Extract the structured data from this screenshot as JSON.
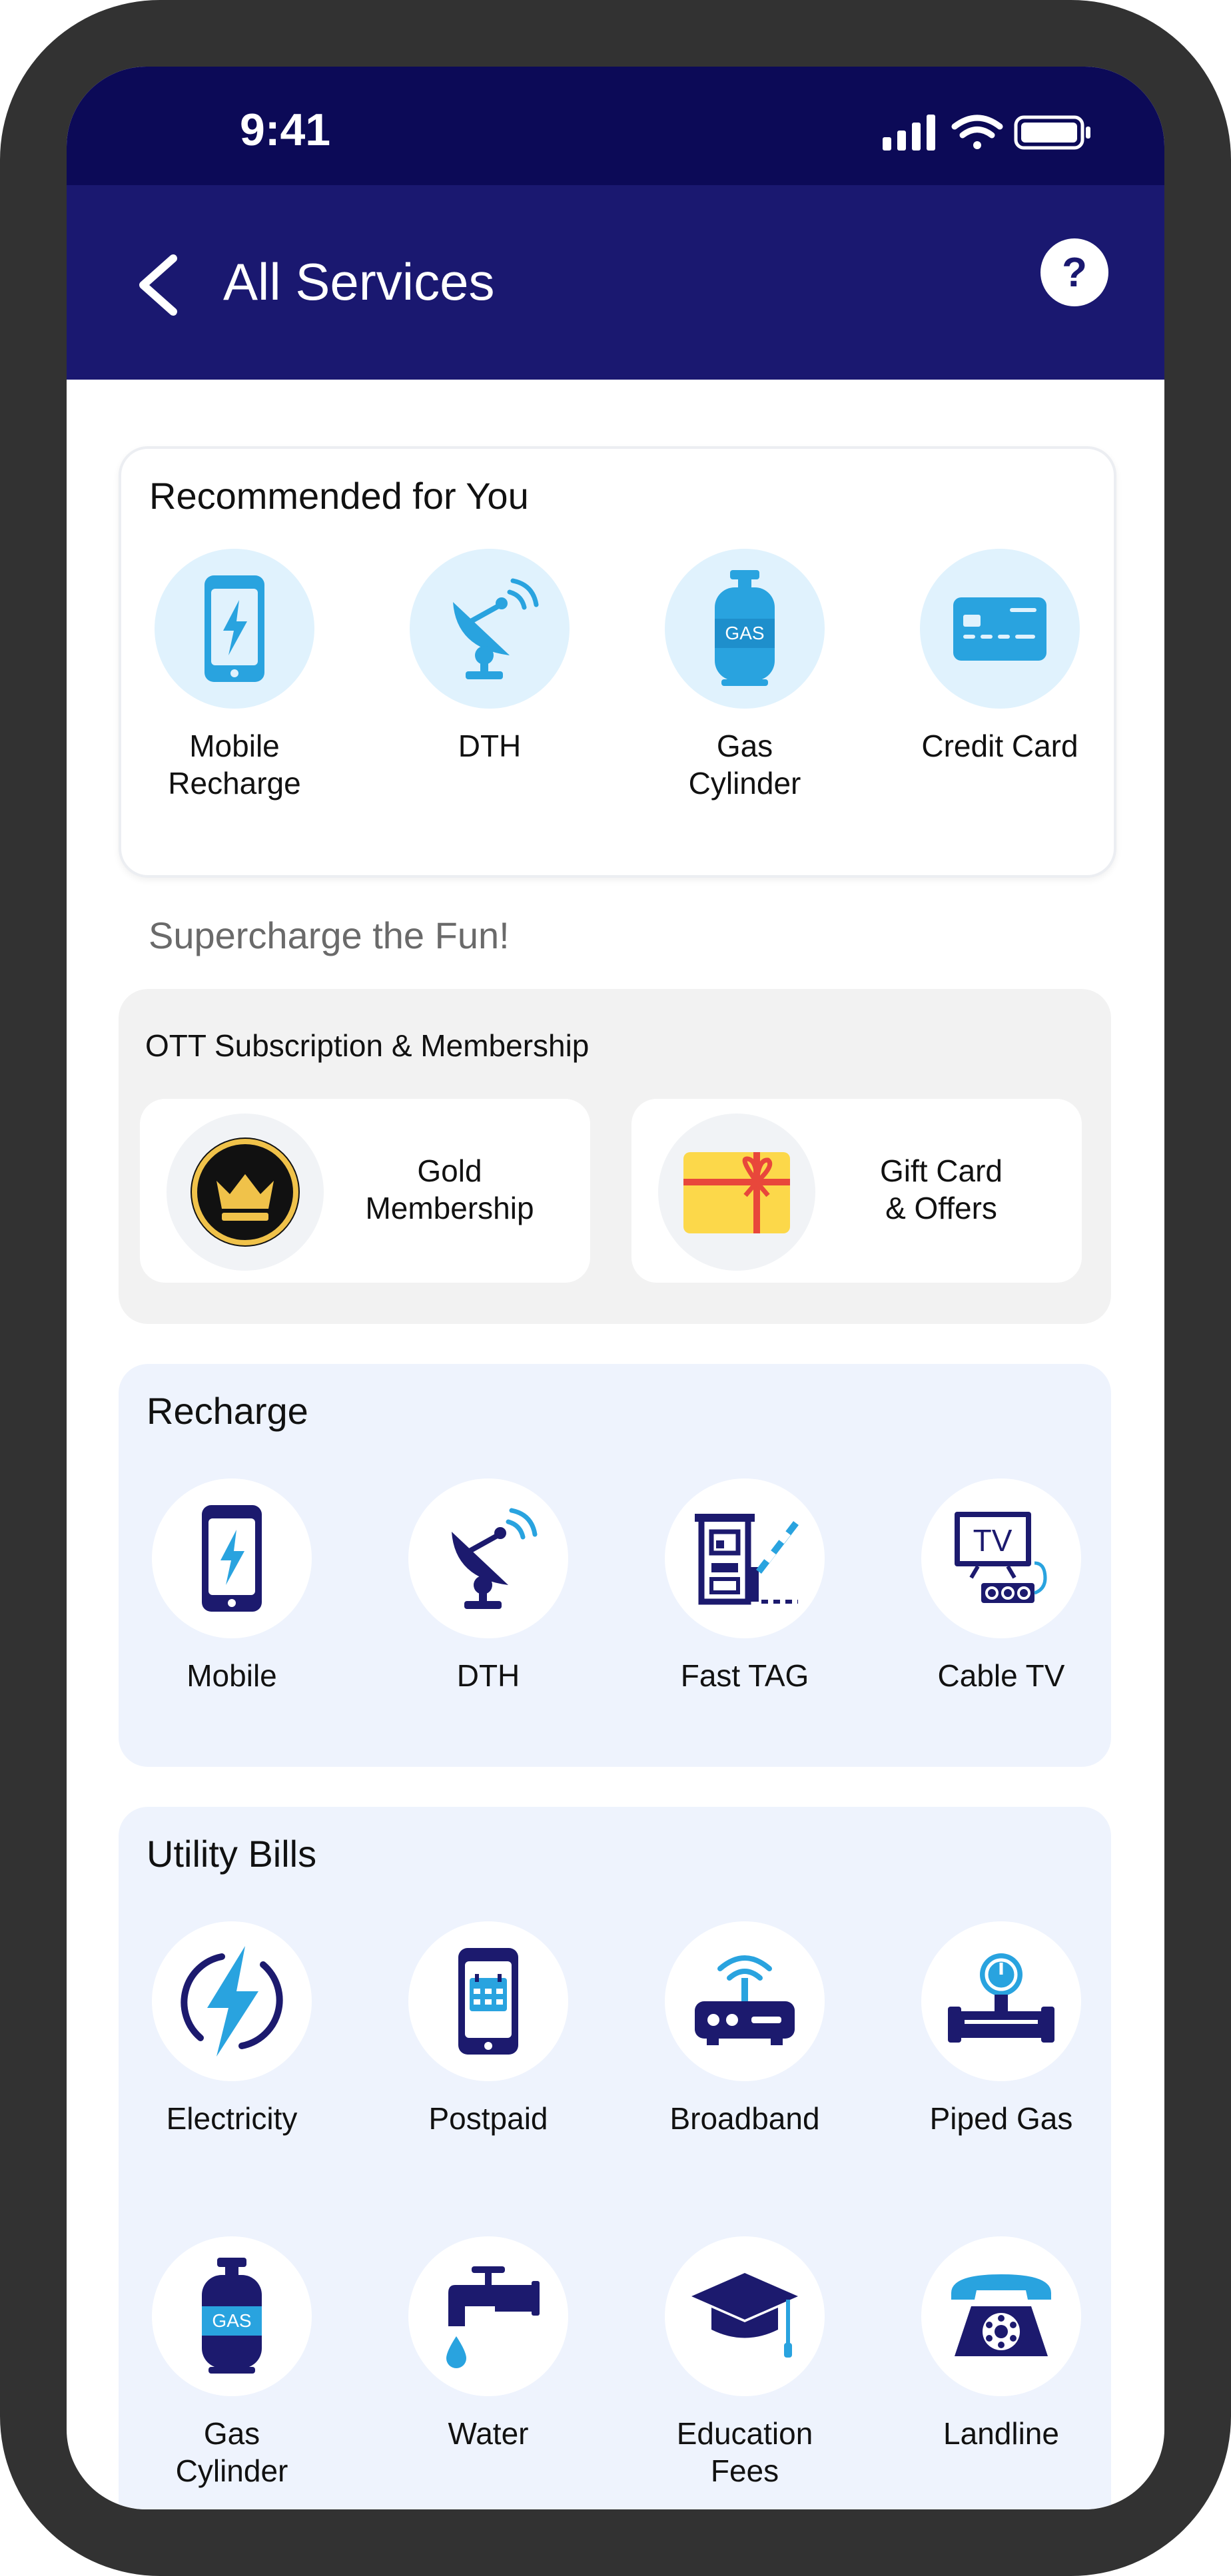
{
  "status_bar": {
    "time": "9:41"
  },
  "header": {
    "title": "All Services",
    "help_label": "?"
  },
  "recommended": {
    "title": "Recommended for You",
    "items": [
      {
        "label": "Mobile Recharge",
        "icon": "mobile-lightning-icon"
      },
      {
        "label": "DTH",
        "icon": "satellite-dish-icon"
      },
      {
        "label": "Gas Cylinder",
        "icon": "gas-cylinder-icon"
      },
      {
        "label": "Credit Card",
        "icon": "credit-card-icon"
      }
    ]
  },
  "supercharge": {
    "heading": "Supercharge the Fun!",
    "title": "OTT Subscription & Membership",
    "items": [
      {
        "label": "Gold Membership",
        "icon": "crown-icon"
      },
      {
        "label": "Gift Card & Offers",
        "icon": "gift-card-icon"
      }
    ]
  },
  "recharge": {
    "title": "Recharge",
    "items": [
      {
        "label": "Mobile",
        "icon": "mobile-lightning-icon"
      },
      {
        "label": "DTH",
        "icon": "satellite-dish-icon"
      },
      {
        "label": "Fast TAG",
        "icon": "toll-gate-icon"
      },
      {
        "label": "Cable TV",
        "icon": "tv-icon",
        "icon_text": "TV"
      }
    ]
  },
  "utility": {
    "title": "Utility Bills",
    "items": [
      {
        "label": "Electricity",
        "icon": "lightning-icon"
      },
      {
        "label": "Postpaid",
        "icon": "mobile-calendar-icon"
      },
      {
        "label": "Broadband",
        "icon": "router-icon"
      },
      {
        "label": "Piped Gas",
        "icon": "gas-meter-icon"
      },
      {
        "label": "Gas Cylinder",
        "icon": "gas-cylinder-icon"
      },
      {
        "label": "Water",
        "icon": "water-tap-icon"
      },
      {
        "label": "Education Fees",
        "icon": "graduation-cap-icon"
      },
      {
        "label": "Landline",
        "icon": "telephone-icon"
      }
    ]
  },
  "icon_text": {
    "gas": "GAS"
  },
  "colors": {
    "status_bar": "#0c0a57",
    "header": "#1a1870",
    "accent_blue": "#29a3df",
    "icon_navy": "#1c1a6e",
    "gold": "#f0c24a",
    "gift_yellow": "#fcd84a",
    "gift_ribbon": "#e8473b"
  }
}
